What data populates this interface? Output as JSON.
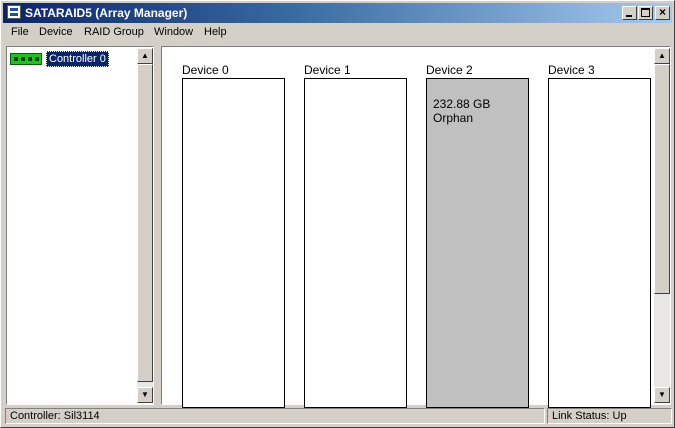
{
  "window": {
    "title": "SATARAID5 (Array Manager)"
  },
  "menu": [
    "File",
    "Device",
    "RAID Group",
    "Window",
    "Help"
  ],
  "tree": {
    "controller_label": "Controller 0"
  },
  "devices": [
    {
      "name": "Device 0",
      "size": "",
      "status": ""
    },
    {
      "name": "Device 1",
      "size": "",
      "status": ""
    },
    {
      "name": "Device 2",
      "size": "232.88 GB",
      "status": "Orphan"
    },
    {
      "name": "Device 3",
      "size": "",
      "status": ""
    }
  ],
  "statusbar": {
    "controller": "Controller: Sil3114",
    "link": "Link Status: Up"
  },
  "colors": {
    "title_start": "#0a246a",
    "title_end": "#a6caf0",
    "orphan_fill": "#c0c0c0",
    "controller_icon": "#20c020"
  }
}
